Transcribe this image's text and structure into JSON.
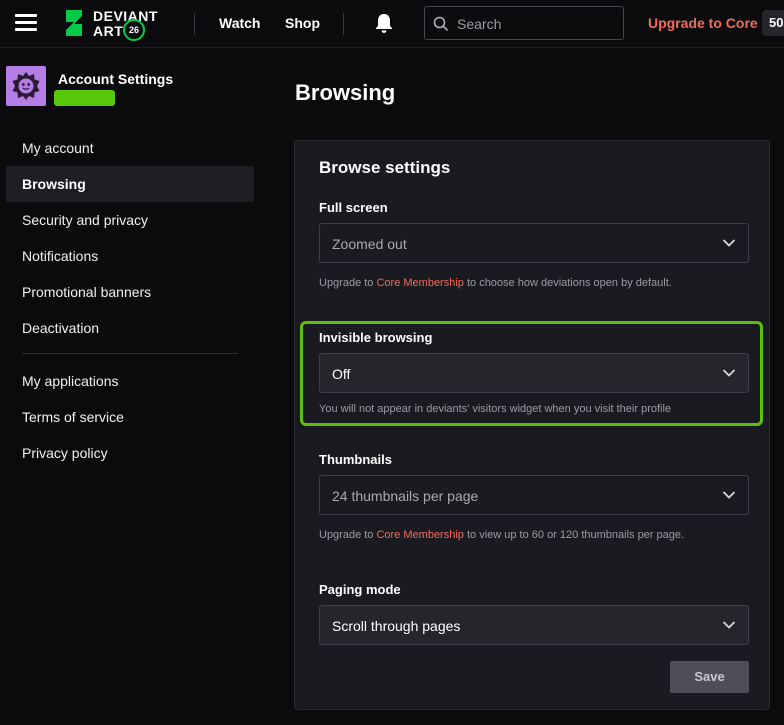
{
  "header": {
    "logo_text_top": "DEVIANT",
    "logo_text_bottom": "ART",
    "logo_badge": "26",
    "nav": [
      "Watch",
      "Shop"
    ],
    "search_placeholder": "Search",
    "upgrade_label": "Upgrade to Core",
    "points": "50"
  },
  "sidebar": {
    "title": "Account Settings",
    "items": [
      {
        "label": "My account"
      },
      {
        "label": "Browsing"
      },
      {
        "label": "Security and privacy"
      },
      {
        "label": "Notifications"
      },
      {
        "label": "Promotional banners"
      },
      {
        "label": "Deactivation"
      },
      {
        "label": "My applications"
      },
      {
        "label": "Terms of service"
      },
      {
        "label": "Privacy policy"
      }
    ],
    "active_index": 1
  },
  "main": {
    "page_title": "Browsing",
    "panel_title": "Browse settings",
    "fields": [
      {
        "label": "Full screen",
        "value": "Zoomed out",
        "help_prefix": "Upgrade to ",
        "help_link": "Core Membership",
        "help_suffix": " to choose how deviations open by default."
      },
      {
        "label": "Invisible browsing",
        "value": "Off",
        "help": "You will not appear in deviants' visitors widget when you visit their profile"
      },
      {
        "label": "Thumbnails",
        "value": "24 thumbnails per page",
        "help_prefix": "Upgrade to ",
        "help_link": "Core Membership",
        "help_suffix": " to view up to 60 or 120 thumbnails per page."
      },
      {
        "label": "Paging mode",
        "value": "Scroll through pages"
      }
    ],
    "save_label": "Save"
  },
  "colors": {
    "accent": "#f26b5b",
    "highlight": "#5bc10a",
    "brand_green": "#05cc47",
    "avatar_bg": "#b57ee6"
  }
}
